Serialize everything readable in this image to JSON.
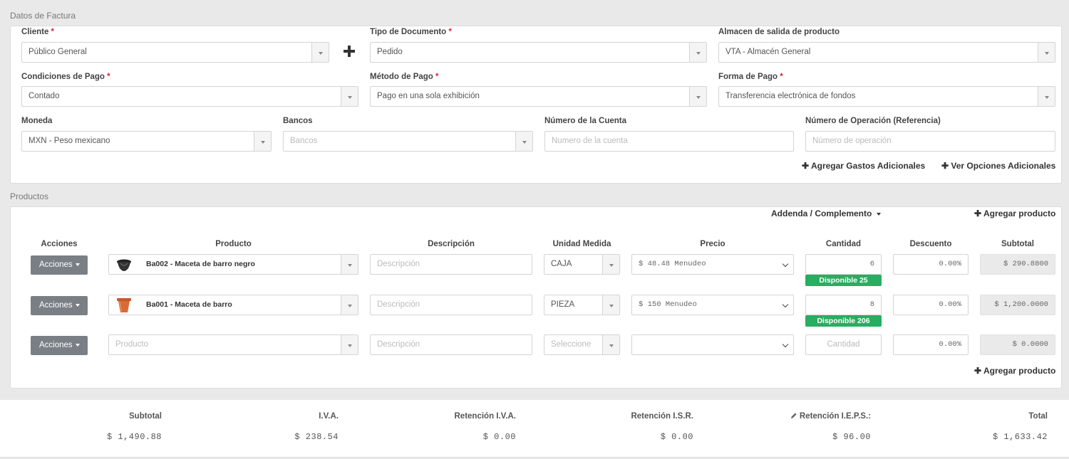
{
  "invoice": {
    "section_title": "Datos de Factura",
    "cliente": {
      "label": "Cliente",
      "value": "Público General"
    },
    "tipo_documento": {
      "label": "Tipo de Documento",
      "value": "Pedido"
    },
    "almacen": {
      "label": "Almacen de salida de producto",
      "value": "VTA - Almacén General"
    },
    "condiciones": {
      "label": "Condiciones de Pago",
      "value": "Contado"
    },
    "metodo": {
      "label": "Método de Pago",
      "value": "Pago en una sola exhibición"
    },
    "forma": {
      "label": "Forma de Pago",
      "value": "Transferencia electrónica de fondos"
    },
    "moneda": {
      "label": "Moneda",
      "value": "MXN - Peso mexicano"
    },
    "bancos": {
      "label": "Bancos",
      "placeholder": "Bancos"
    },
    "cuenta": {
      "label": "Número de la Cuenta",
      "placeholder": "Numero de la cuenta"
    },
    "operacion": {
      "label": "Número de Operación (Referencia)",
      "placeholder": "Número de operación"
    },
    "add_gastos": "Agregar Gastos Adicionales",
    "ver_opciones": "Ver Opciones Adicionales",
    "required_mark": "*"
  },
  "products": {
    "section_title": "Productos",
    "addenda": "Addenda / Complemento",
    "add_product": "Agregar producto",
    "headers": [
      "Acciones",
      "Producto",
      "Descripción",
      "Unidad Medida",
      "Precio",
      "Cantidad",
      "Descuento",
      "Subtotal"
    ],
    "actions_label": "Acciones",
    "desc_placeholder": "Descripción",
    "rows": [
      {
        "product": "Ba002 - Maceta de barro negro",
        "unit": "CAJA",
        "price": "$ 48.48 Menudeo",
        "qty": "6",
        "available": "Disponible 25",
        "discount": "0.00%",
        "subtotal": "$ 290.8800"
      },
      {
        "product": "Ba001 - Maceta de barro",
        "unit": "PIEZA",
        "price": "$ 150 Menudeo",
        "qty": "8",
        "available": "Disponible 206",
        "discount": "0.00%",
        "subtotal": "$ 1,200.0000"
      },
      {
        "product_placeholder": "Producto",
        "unit_placeholder": "Seleccione",
        "qty_placeholder": "Cantidad",
        "discount": "0.00%",
        "subtotal": "$ 0.0000"
      }
    ]
  },
  "totals": {
    "subtotal": {
      "label": "Subtotal",
      "value": "$ 1,490.88"
    },
    "iva": {
      "label": "I.V.A.",
      "value": "$ 238.54"
    },
    "ret_iva": {
      "label": "Retención I.V.A.",
      "value": "$ 0.00"
    },
    "ret_isr": {
      "label": "Retención I.S.R.",
      "value": "$ 0.00"
    },
    "ret_ieps": {
      "label": "Retención I.E.P.S.:",
      "value": "$ 96.00"
    },
    "total": {
      "label": "Total",
      "value": "$ 1,633.42"
    }
  },
  "colors": {
    "badge": "#27ae60",
    "button": "#7a7f86",
    "required": "#d9232d"
  }
}
